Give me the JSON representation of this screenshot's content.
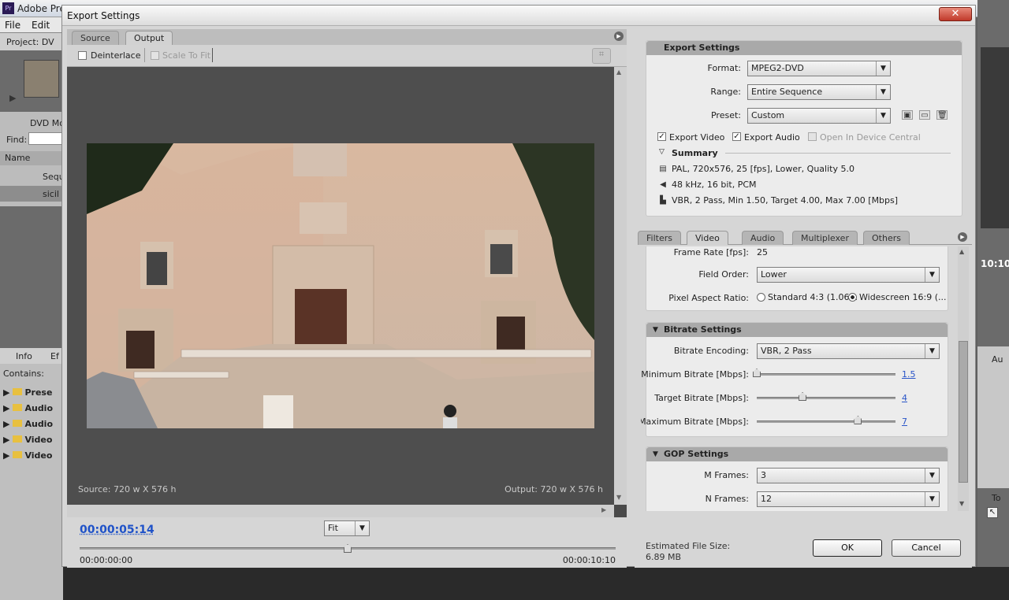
{
  "app": {
    "title": "Adobe Pre",
    "menu": [
      "File",
      "Edit"
    ]
  },
  "bg_panels": {
    "project": "Project: DV",
    "dvd": "DVD Mo",
    "find": "Find:",
    "name_col": "Name",
    "seq": "Sequ",
    "clip": "sicil",
    "info": "Info",
    "effects": "Ef",
    "contains": "Contains:",
    "folders": [
      "Prese",
      "Audio",
      "Audio",
      "Video",
      "Video"
    ],
    "right_time": "10:10",
    "right_ctl": "Au",
    "to": "To"
  },
  "dialog": {
    "title": "Export Settings",
    "close": "✕"
  },
  "source_tabs": [
    {
      "label": "Source",
      "active": false
    },
    {
      "label": "Output",
      "active": true
    }
  ],
  "options": {
    "deinterlace": "Deinterlace",
    "scale_to_fit": "Scale To Fit"
  },
  "preview": {
    "source_size": "Source: 720 w X 576 h",
    "output_size": "Output: 720 w X 576 h"
  },
  "timeline": {
    "current_time": "00:00:05:14",
    "zoom": "Fit",
    "start": "00:00:00:00",
    "end": "00:00:10:10",
    "playhead_fraction": 0.5
  },
  "export_settings": {
    "heading": "Export Settings",
    "format_label": "Format:",
    "format_value": "MPEG2-DVD",
    "range_label": "Range:",
    "range_value": "Entire Sequence",
    "preset_label": "Preset:",
    "preset_value": "Custom",
    "export_video": "Export Video",
    "export_audio": "Export Audio",
    "open_device": "Open In Device Central",
    "summary_heading": "Summary",
    "summary": [
      "PAL, 720x576, 25 [fps], Lower, Quality 5.0",
      "48 kHz, 16 bit, PCM",
      "VBR, 2 Pass, Min 1.50, Target 4.00, Max 7.00 [Mbps]"
    ]
  },
  "settings_tabs": [
    {
      "label": "Filters"
    },
    {
      "label": "Video",
      "active": true
    },
    {
      "label": "Audio"
    },
    {
      "label": "Multiplexer"
    },
    {
      "label": "Others"
    }
  ],
  "video": {
    "frame_rate_label": "Frame Rate [fps]:",
    "frame_rate_value": "25",
    "field_order_label": "Field Order:",
    "field_order_value": "Lower",
    "par_label": "Pixel Aspect Ratio:",
    "par_standard": "Standard 4:3 (1.06...",
    "par_wide": "Widescreen 16:9 (...",
    "bitrate_heading": "Bitrate Settings",
    "encoding_label": "Bitrate Encoding:",
    "encoding_value": "VBR, 2 Pass",
    "min_label": "Minimum Bitrate [Mbps]:",
    "min_value": "1.5",
    "min_fraction": 0.0,
    "target_label": "Target Bitrate [Mbps]:",
    "target_value": "4",
    "target_fraction": 0.33,
    "max_label": "Maximum Bitrate [Mbps]:",
    "max_value": "7",
    "max_fraction": 0.73,
    "gop_heading": "GOP Settings",
    "m_label": "M Frames:",
    "m_value": "3",
    "n_label": "N Frames:",
    "n_value": "12"
  },
  "footer": {
    "size_label": "Estimated File Size:",
    "size_value": "6.89 MB",
    "ok": "OK",
    "cancel": "Cancel"
  }
}
